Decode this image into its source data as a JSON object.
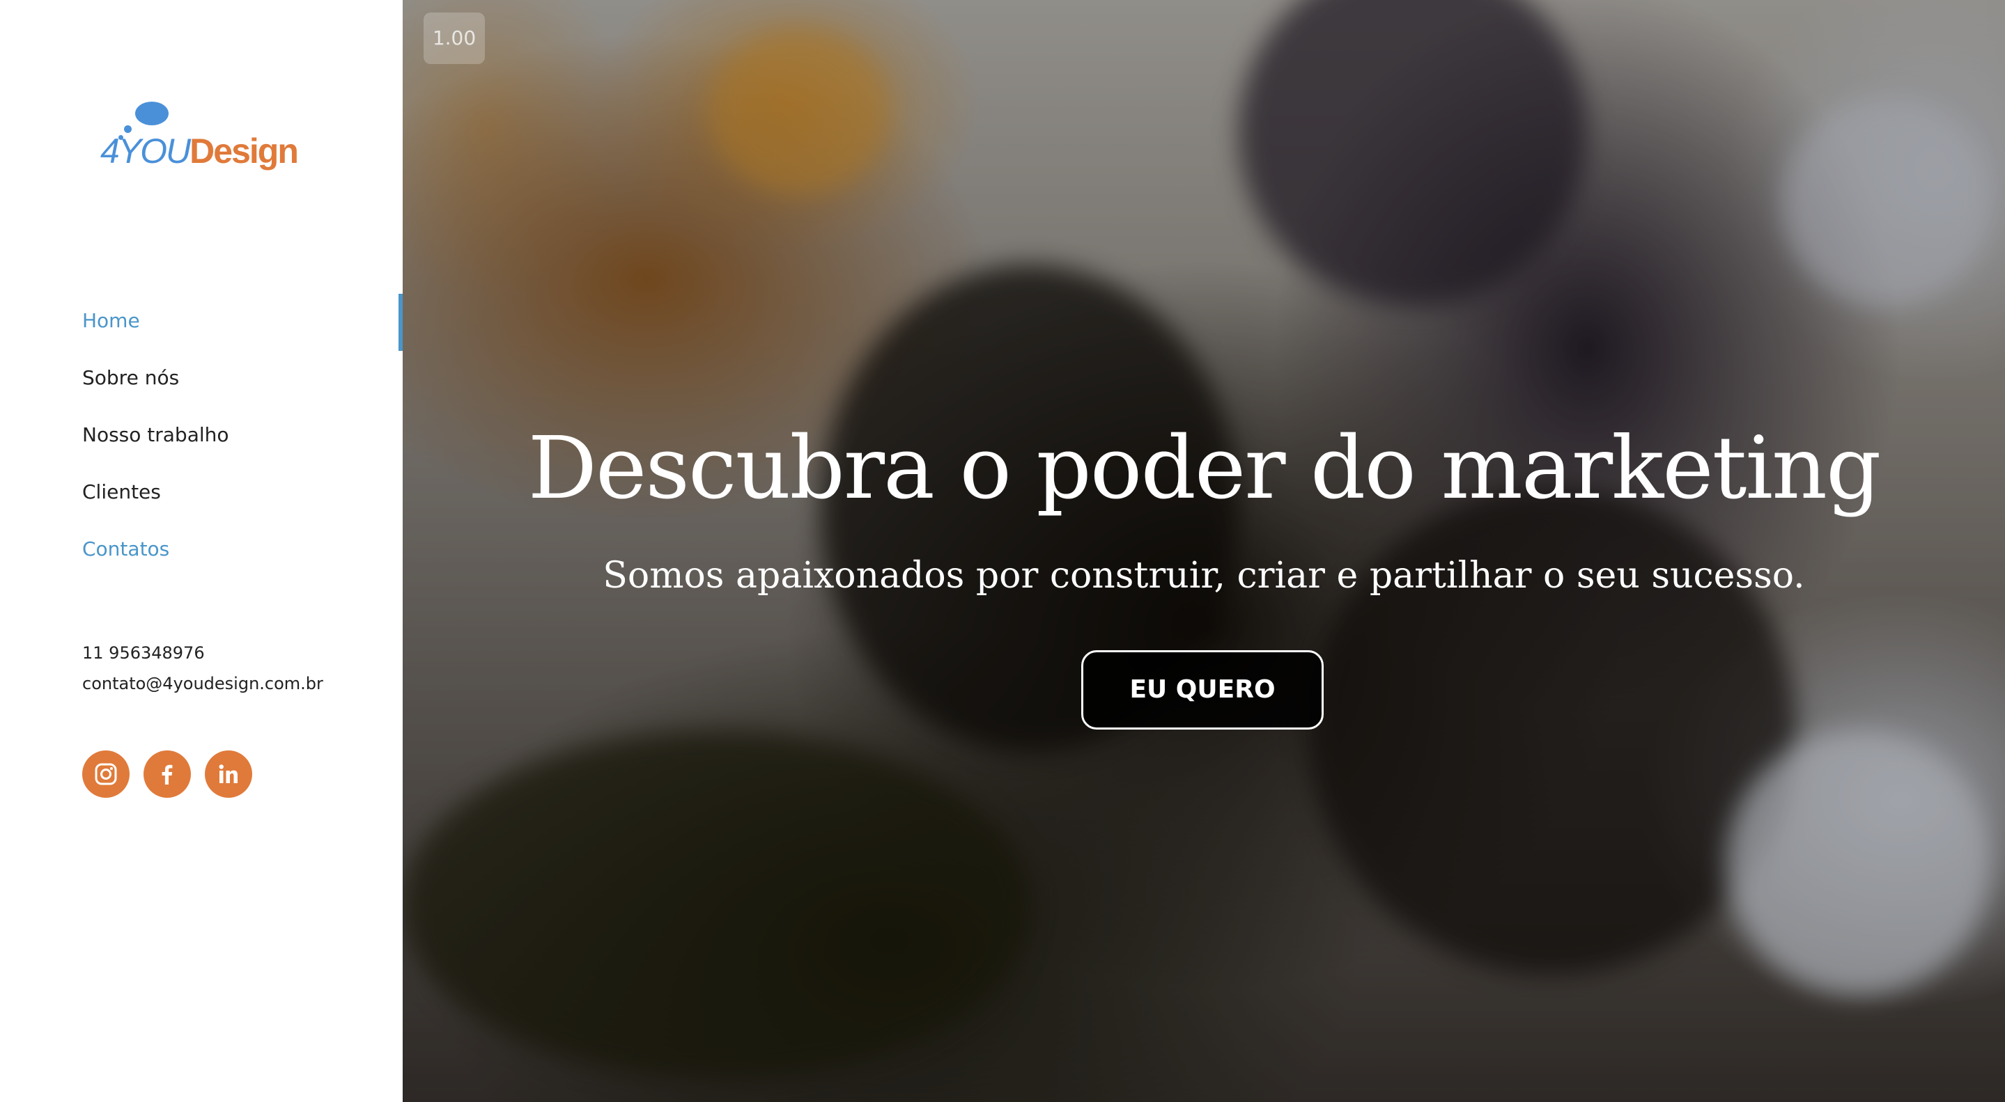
{
  "logo": {
    "prefix": "4YOU",
    "suffix": "Design"
  },
  "nav": {
    "items": [
      {
        "label": "Home"
      },
      {
        "label": "Sobre nós"
      },
      {
        "label": "Nosso trabalho"
      },
      {
        "label": "Clientes"
      },
      {
        "label": "Contatos"
      }
    ]
  },
  "contact": {
    "phone": "11 956348976",
    "email": "contato@4youdesign.com.br"
  },
  "social": {
    "icons": [
      "instagram-icon",
      "facebook-icon",
      "linkedin-icon"
    ]
  },
  "video": {
    "speed": "1.00"
  },
  "hero": {
    "title": "Descubra o poder do marketing",
    "subtitle": "Somos apaixonados por construir, criar e partilhar o seu sucesso.",
    "cta_label": "EU QUERO"
  },
  "colors": {
    "accent_blue": "#4a95c9",
    "accent_orange": "#e07a3a",
    "text_dark": "#222222"
  }
}
